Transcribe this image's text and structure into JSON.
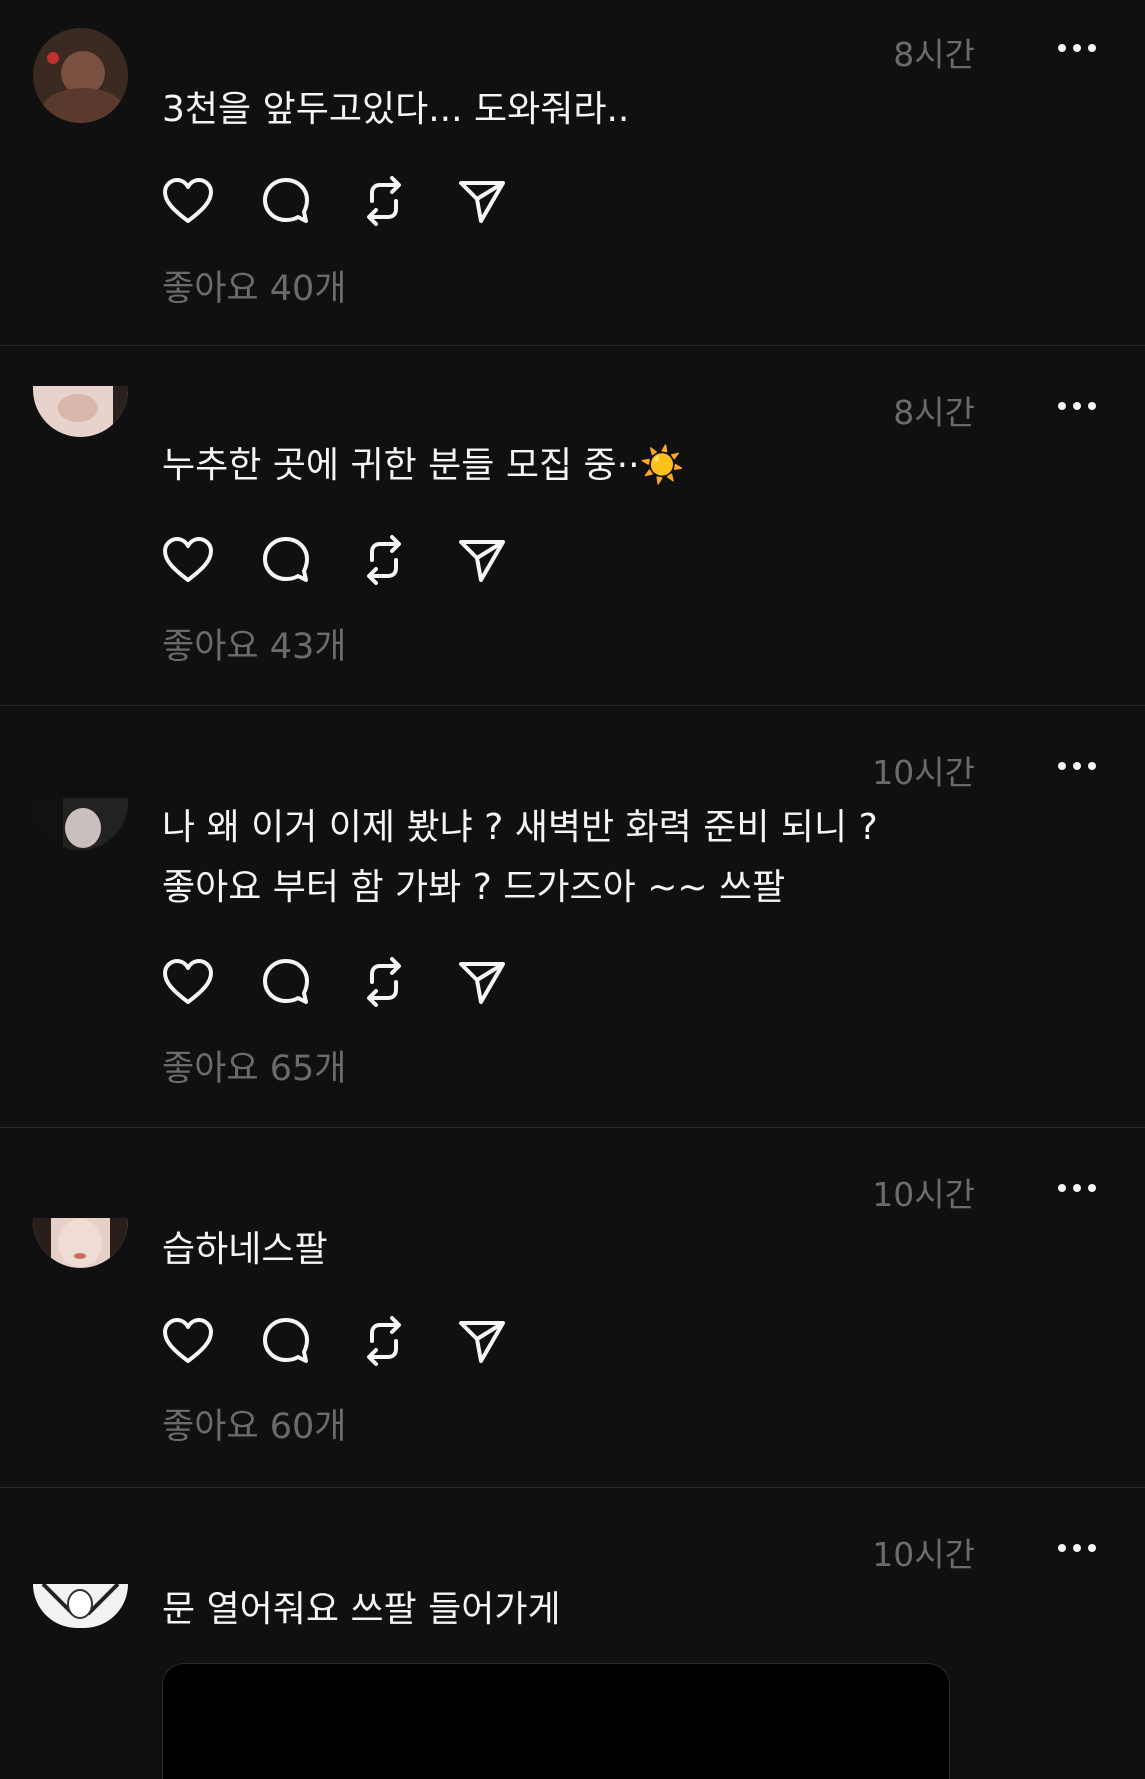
{
  "posts": [
    {
      "time": "8시간",
      "text": "3천을 앞두고있다... 도와줘라..",
      "likes": "좋아요 40개",
      "avatar": "avatar-photo-dark"
    },
    {
      "time": "8시간",
      "text": "누추한 곳에 귀한 분들 모집 중··☀️",
      "likes": "좋아요 43개",
      "avatar": "avatar-photo-light"
    },
    {
      "time": "10시간",
      "text": "나 왜 이거 이제 봤냐 ? 새벽반 화력 준비 되니 ?\n좋아요 부터 함 가봐 ? 드가즈아 ~~ 쓰팔",
      "likes": "좋아요 65개",
      "avatar": "avatar-photo-mono"
    },
    {
      "time": "10시간",
      "text": "습하네스팔",
      "likes": "좋아요 60개",
      "avatar": "avatar-photo-face"
    },
    {
      "time": "10시간",
      "text": "문 열어줘요 쓰팔 들어가게",
      "likes": "",
      "avatar": "avatar-photo-sketch"
    }
  ],
  "icons": {
    "like": "heart-icon",
    "comment": "comment-icon",
    "repost": "repost-icon",
    "share": "send-icon",
    "more": "more-dots-icon"
  },
  "colors": {
    "background": "#101010",
    "text": "#f3f5f7",
    "muted": "#6b6b6b",
    "divider": "#2a2a2a"
  }
}
